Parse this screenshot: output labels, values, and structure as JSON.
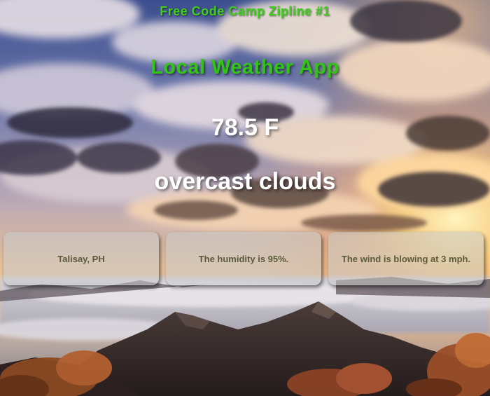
{
  "header": {
    "title": "Free Code Camp Zipline #1",
    "app_title": "Local Weather App"
  },
  "weather": {
    "temperature": "78.5 F",
    "description": "overcast clouds"
  },
  "cards": [
    {
      "text": "Talisay, PH"
    },
    {
      "text": "The humidity is 95%."
    },
    {
      "text": "The wind is blowing at 3 mph."
    }
  ],
  "colors": {
    "title_green": "#3fcf1c",
    "app_title_green": "#33c515",
    "card_text": "#5a5a3a"
  }
}
